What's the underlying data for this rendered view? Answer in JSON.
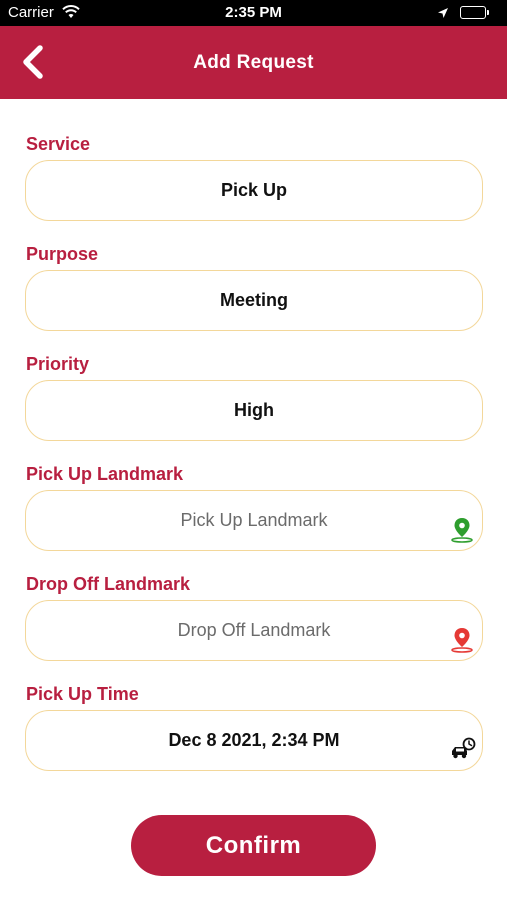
{
  "status_bar": {
    "carrier": "Carrier",
    "time": "2:35 PM",
    "battery_color": "#4cd964"
  },
  "header": {
    "title": "Add Request",
    "back_icon": "chevron-left-icon",
    "background": "#b81f40"
  },
  "form": {
    "service": {
      "label": "Service",
      "value": "Pick Up"
    },
    "purpose": {
      "label": "Purpose",
      "value": "Meeting"
    },
    "priority": {
      "label": "Priority",
      "value": "High"
    },
    "pickup_landmark": {
      "label": "Pick Up Landmark",
      "placeholder": "Pick Up Landmark",
      "icon": "green-map-pin-icon",
      "icon_color": "#2e9e2e"
    },
    "dropoff_landmark": {
      "label": "Drop Off Landmark",
      "placeholder": "Drop Off Landmark",
      "icon": "red-map-pin-icon",
      "icon_color": "#e53935"
    },
    "pickup_time": {
      "label": "Pick Up Time",
      "value": "Dec 8 2021, 2:34 PM",
      "icon": "car-clock-icon"
    }
  },
  "confirm_label": "Confirm",
  "colors": {
    "accent": "#b81f40",
    "field_border": "#f3d79a"
  }
}
